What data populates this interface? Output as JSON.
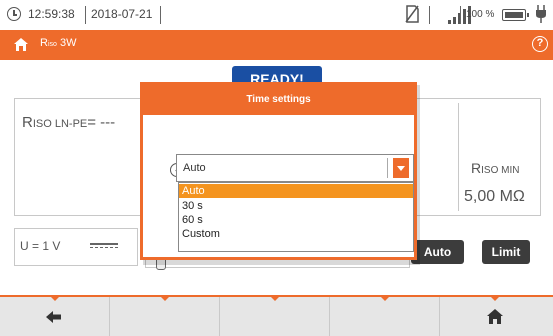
{
  "status_bar": {
    "time": "12:59:38",
    "date": "2018-07-21",
    "battery_percent": "100 %",
    "battery_level": 1.0
  },
  "title_bar": {
    "title_main": "R",
    "title_sub": "iso",
    "title_suffix": " 3W",
    "help": "?"
  },
  "status_label": "READY!",
  "measurement": {
    "result_main": "R",
    "result_sub": "ISO LN-PE",
    "result_value": "= ---",
    "min_main": "R",
    "min_sub": "ISO MIN",
    "min_value": "5,00 MΩ",
    "voltage": "U = 1 V"
  },
  "buttons": {
    "auto": "Auto",
    "limit": "Limit"
  },
  "dialog": {
    "title": "Time settings",
    "selected_value": "Auto",
    "options": [
      "Auto",
      "30 s",
      "60 s",
      "Custom"
    ],
    "highlighted_index": 0
  },
  "colors": {
    "accent": "#ee6b2b",
    "ready": "#1a4fa3",
    "highlight": "#f4941f"
  }
}
